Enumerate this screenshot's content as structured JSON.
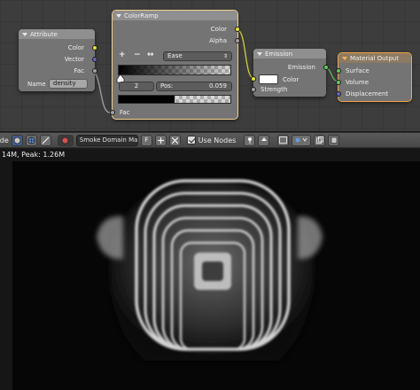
{
  "node_editor": {
    "attribute_node": {
      "title": "Attribute",
      "outputs": [
        "Color",
        "Vector",
        "Fac"
      ],
      "name_label": "Name",
      "name_value": "density"
    },
    "colorramp_node": {
      "title": "ColorRamp",
      "outputs": [
        "Color",
        "Alpha"
      ],
      "add_label": "+",
      "remove_label": "−",
      "flip_label": "↔",
      "interpolation": "Ease",
      "stop_index": "2",
      "pos_label": "Pos:",
      "pos_value": "0.059",
      "input_label": "Fac"
    },
    "emission_node": {
      "title": "Emission",
      "output": "Emission",
      "inputs": [
        "Color",
        "Strength"
      ]
    },
    "output_node": {
      "title": "Material Output",
      "inputs": [
        "Surface",
        "Volume",
        "Displacement"
      ]
    }
  },
  "header": {
    "mode_label": "Mode",
    "material_name": "Smoke Domain Mat",
    "material_users": "F",
    "use_nodes_label": "Use Nodes"
  },
  "viewport": {
    "stats": "14M, Peak: 1.26M"
  },
  "colors": {
    "yellow_socket": "#e8e42a",
    "blue_socket": "#6363c7",
    "grey_socket": "#a1a1a1",
    "green_socket": "#63c763",
    "active_outline": "#f3a44a"
  }
}
